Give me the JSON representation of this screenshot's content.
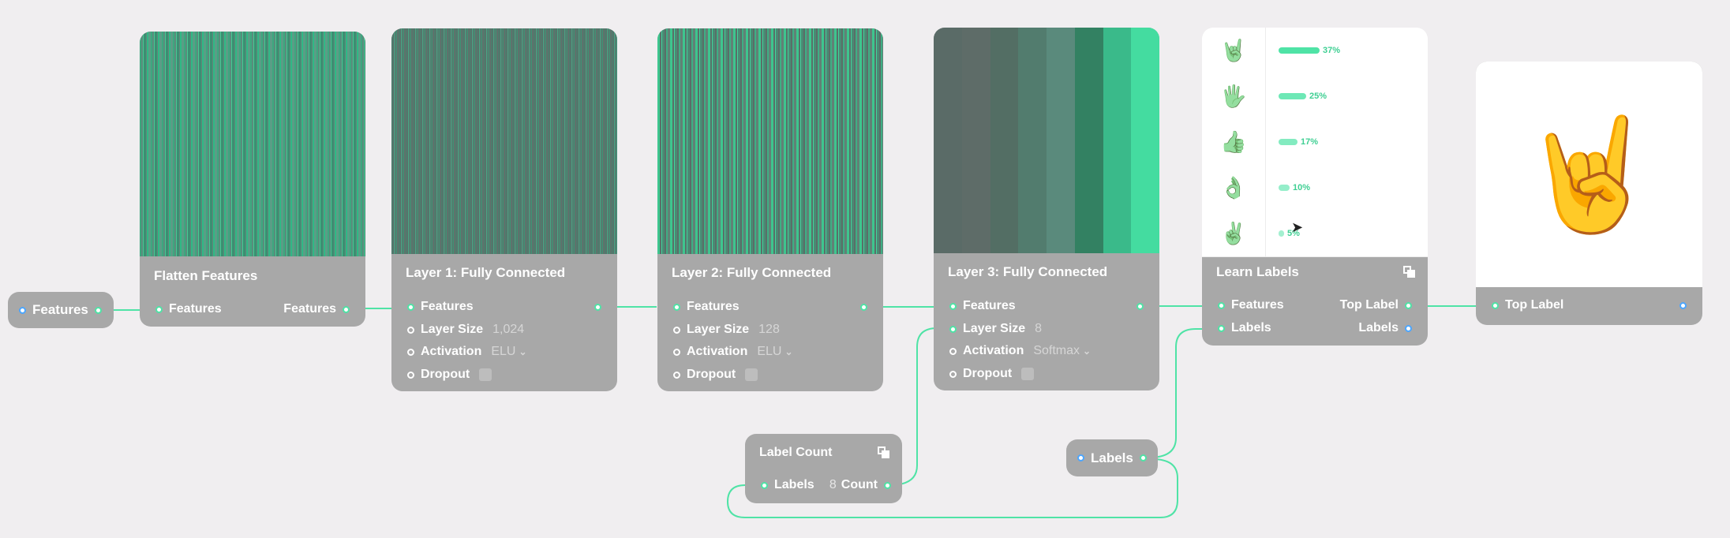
{
  "colors": {
    "wire": "#4fe3a6",
    "node": "#a8a8a8",
    "bg": "#f0eef0",
    "port_blue": "#4ca6ff"
  },
  "input_features": {
    "label": "Features"
  },
  "flatten": {
    "title": "Flatten Features",
    "in_label": "Features",
    "out_label": "Features"
  },
  "layer1": {
    "title": "Layer 1: Fully Connected",
    "features": "Features",
    "layer_size_label": "Layer Size",
    "layer_size_value": "1,024",
    "activation_label": "Activation",
    "activation_value": "ELU",
    "dropout_label": "Dropout"
  },
  "layer2": {
    "title": "Layer 2: Fully Connected",
    "features": "Features",
    "layer_size_label": "Layer Size",
    "layer_size_value": "128",
    "activation_label": "Activation",
    "activation_value": "ELU",
    "dropout_label": "Dropout"
  },
  "layer3": {
    "title": "Layer 3: Fully Connected",
    "features": "Features",
    "layer_size_label": "Layer Size",
    "layer_size_value": "8",
    "activation_label": "Activation",
    "activation_value": "Softmax",
    "dropout_label": "Dropout"
  },
  "learn_labels": {
    "title": "Learn Labels",
    "features": "Features",
    "labels": "Labels",
    "top_label_out": "Top Label",
    "labels_out": "Labels",
    "predictions": [
      {
        "emoji": "🤘",
        "percent_text": "37%",
        "value": 0.37
      },
      {
        "emoji": "🖐",
        "percent_text": "25%",
        "value": 0.25
      },
      {
        "emoji": "👍",
        "percent_text": "17%",
        "value": 0.17
      },
      {
        "emoji": "👌",
        "percent_text": "10%",
        "value": 0.1
      },
      {
        "emoji": "✌",
        "percent_text": "5%",
        "value": 0.05
      }
    ]
  },
  "top_label": {
    "label": "Top Label",
    "emoji": "🤘"
  },
  "label_count": {
    "title": "Label Count",
    "labels": "Labels",
    "count_value": "8",
    "count_label": "Count"
  },
  "labels_pill": {
    "label": "Labels"
  },
  "viz": {
    "layer3_stripes": [
      "#5a6b67",
      "#5e6c68",
      "#536e64",
      "#527c6e",
      "#5a8a7c",
      "#338162",
      "#3aba8a",
      "#44dca0"
    ]
  }
}
